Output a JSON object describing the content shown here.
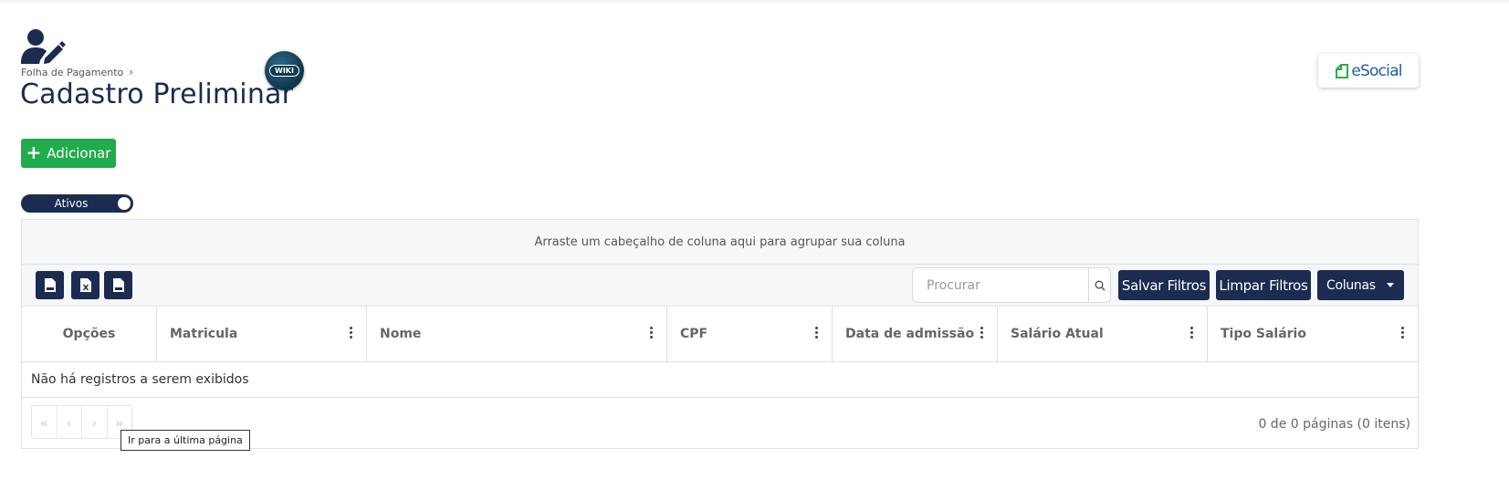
{
  "header": {
    "breadcrumb": [
      "Folha de Pagamento"
    ],
    "title": "Cadastro Preliminar",
    "wiki_badge": "WIKI",
    "esocial_logo": "eSocial"
  },
  "actions": {
    "add_label": "Adicionar",
    "toggle_label": "Ativos"
  },
  "grid": {
    "group_panel_text": "Arraste um cabeçalho de coluna aqui para agrupar sua coluna",
    "toolbar": {
      "export_icons": [
        "pdf-icon",
        "excel-icon",
        "csv-icon"
      ],
      "search_placeholder": "Procurar",
      "save_filters": "Salvar Filtros",
      "clear_filters": "Limpar Filtros",
      "columns": "Colunas"
    },
    "columns": [
      "Opções",
      "Matricula",
      "Nome",
      "CPF",
      "Data de admissão",
      "Salário Atual",
      "Tipo Salário"
    ],
    "empty_message": "Não há registros a serem exibidos",
    "pager_info": "0 de 0 páginas (0 itens)",
    "tooltip": "Ir para a última página"
  },
  "colors": {
    "navy": "#1c2b50",
    "green": "#21ab4c",
    "esocial_blue": "#1f5fa0"
  }
}
